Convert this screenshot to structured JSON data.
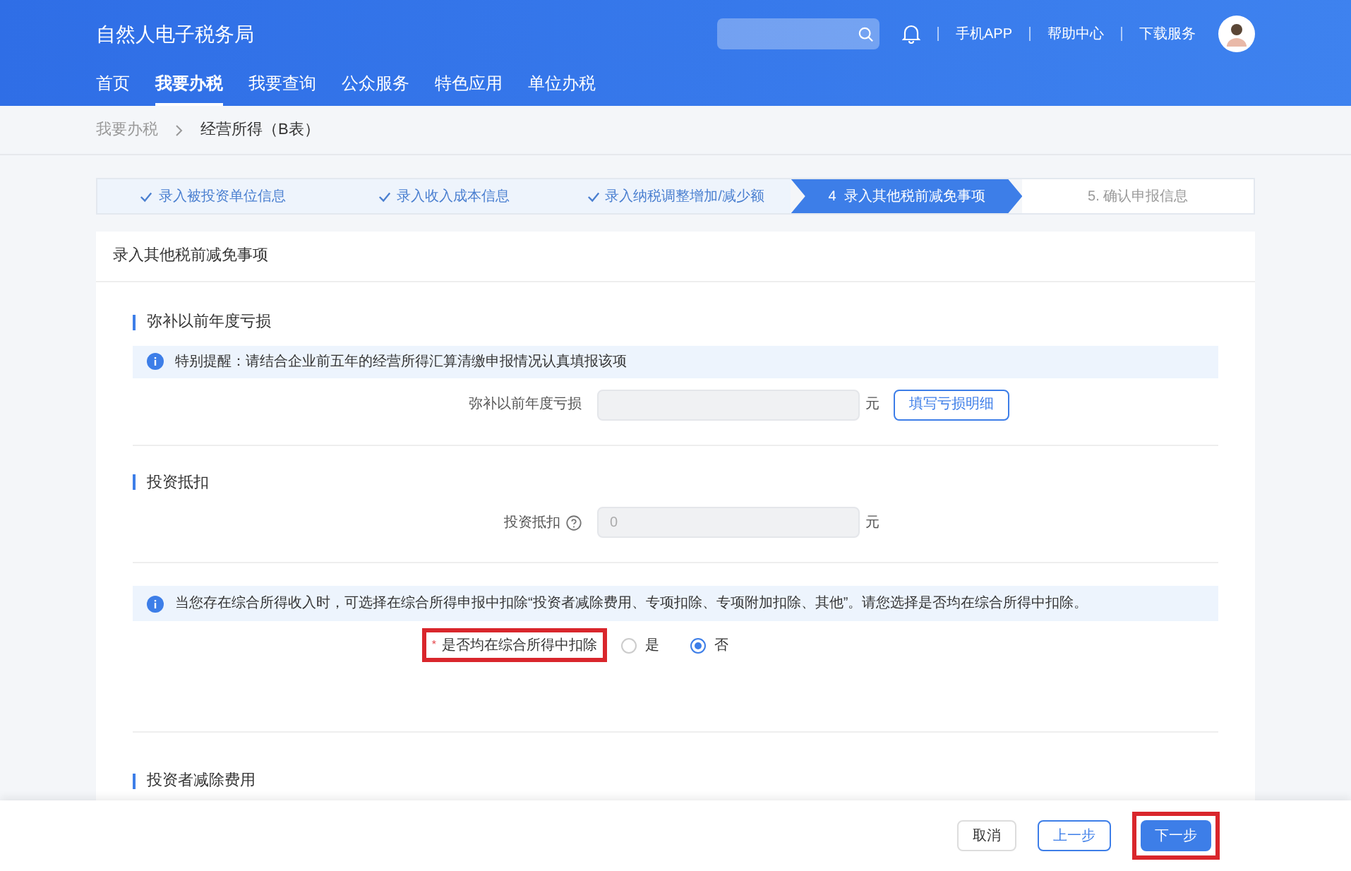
{
  "header": {
    "title": "自然人电子税务局",
    "links": [
      "手机APP",
      "帮助中心",
      "下载服务"
    ]
  },
  "nav": [
    {
      "label": "首页",
      "selected": false
    },
    {
      "label": "我要办税",
      "selected": true
    },
    {
      "label": "我要查询",
      "selected": false
    },
    {
      "label": "公众服务",
      "selected": false
    },
    {
      "label": "特色应用",
      "selected": false
    },
    {
      "label": "单位办税",
      "selected": false
    }
  ],
  "breadcrumb": [
    "我要办税",
    "经营所得（B表）"
  ],
  "steps": [
    {
      "label": "录入被投资单位信息",
      "kind": "done"
    },
    {
      "label": "录入收入成本信息",
      "kind": "done"
    },
    {
      "label": "录入纳税调整增加/减少额",
      "kind": "done"
    },
    {
      "label": "4  录入其他税前减免事项",
      "kind": "active"
    },
    {
      "label": "5. 确认申报信息",
      "kind": "pending"
    }
  ],
  "card": {
    "title": "录入其他税前减免事项",
    "loss": {
      "heading": "弥补以前年度亏损",
      "notice": "特别提醒：请结合企业前五年的经营所得汇算清缴申报情况认真填报该项",
      "label": "弥补以前年度亏损",
      "unit": "元",
      "button": "填写亏损明细"
    },
    "invest": {
      "heading": "投资抵扣",
      "label": "投资抵扣",
      "placeholder": "0",
      "unit": "元"
    },
    "comprehensive": {
      "notice": "当您存在综合所得收入时，可选择在综合所得申报中扣除“投资者减除费用、专项扣除、专项附加扣除、其他”。请您选择是否均在综合所得中扣除。",
      "required": "*",
      "label": "是否均在综合所得中扣除",
      "highlighted": true,
      "options": [
        {
          "label": "是",
          "selected": false
        },
        {
          "label": "否",
          "selected": true
        }
      ]
    },
    "next_heading": "投资者减除费用"
  },
  "footer": {
    "buttons": [
      {
        "label": "取消",
        "kind": "plain",
        "highlighted": false
      },
      {
        "label": "上一步",
        "kind": "outline",
        "highlighted": false
      },
      {
        "label": "下一步",
        "kind": "primary",
        "highlighted": true
      }
    ]
  }
}
